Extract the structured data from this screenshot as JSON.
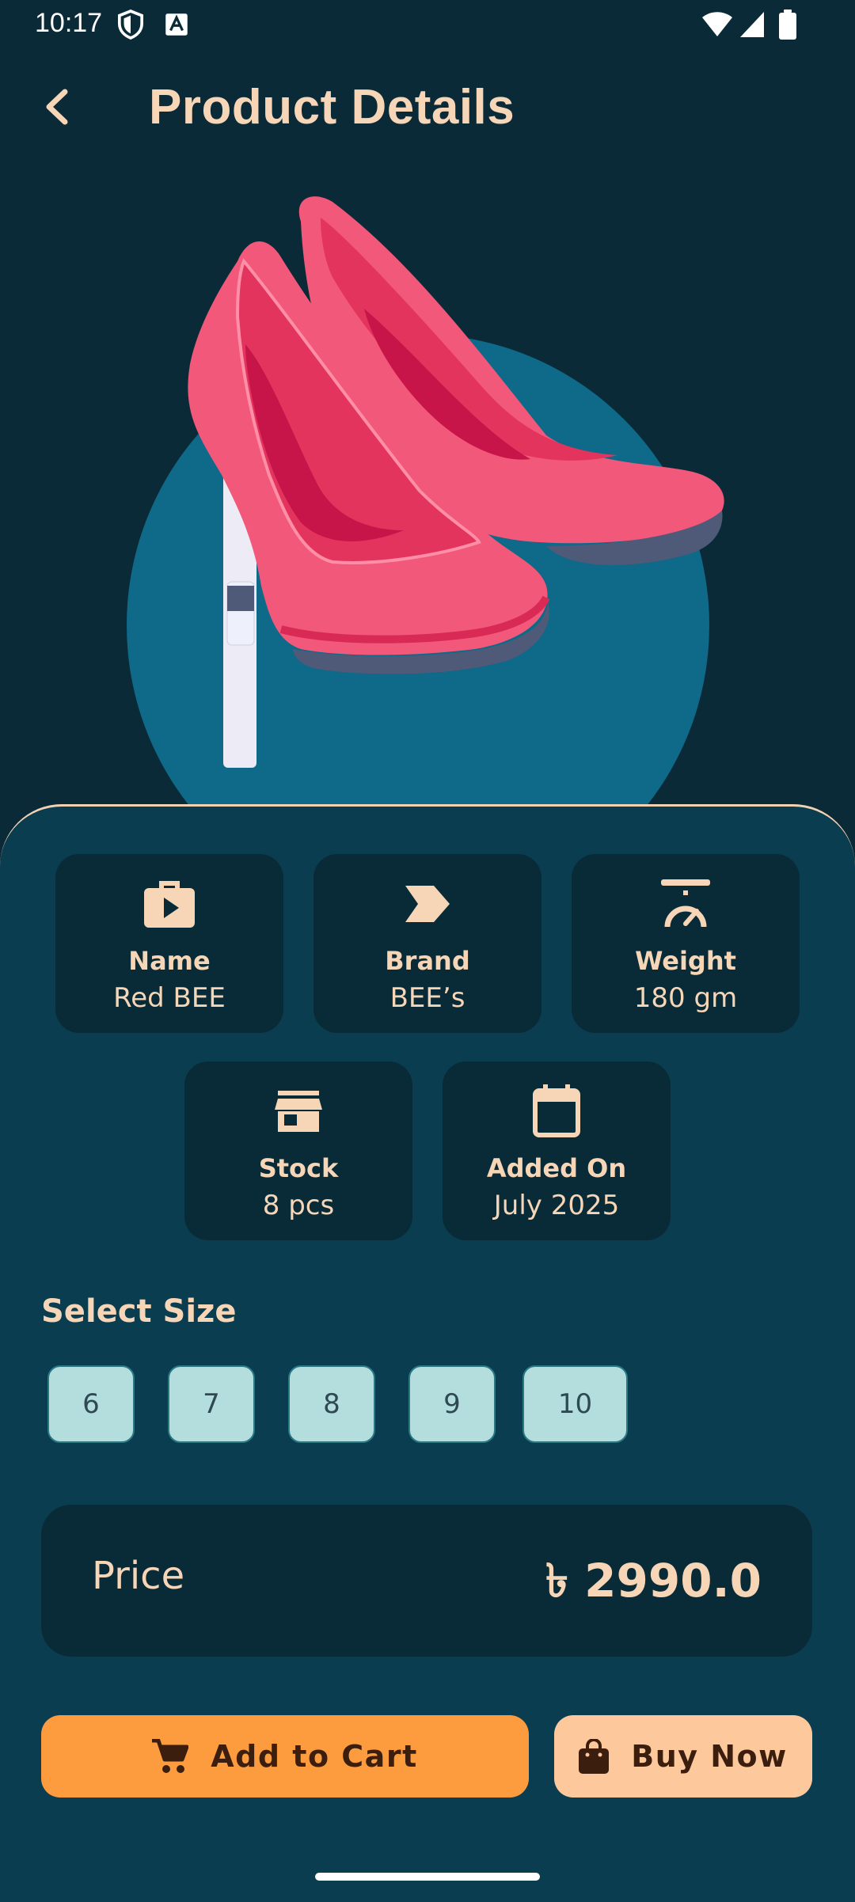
{
  "status_bar": {
    "time": "10:17"
  },
  "app_bar": {
    "title": "Product Details"
  },
  "details": [
    {
      "title": "Name",
      "value": "Red BEE",
      "icon": "video-bag-icon"
    },
    {
      "title": "Brand",
      "value": "BEE’s",
      "icon": "label-icon"
    },
    {
      "title": "Weight",
      "value": "180 gm",
      "icon": "scale-icon"
    },
    {
      "title": "Stock",
      "value": "8 pcs",
      "icon": "store-icon"
    },
    {
      "title": "Added On",
      "value": "July 2025",
      "icon": "calendar-icon"
    }
  ],
  "sizes": {
    "title": "Select Size",
    "options": [
      "6",
      "7",
      "8",
      "9",
      "10"
    ]
  },
  "price": {
    "label": "Price",
    "value": "৳ 2990.0"
  },
  "actions": {
    "add_to_cart": "Add to Cart",
    "buy_now": "Buy Now"
  },
  "colors": {
    "background": "#0b2a37",
    "accent": "#fd9c3f",
    "text": "#f6d6b6",
    "panel": "#0b3d50"
  }
}
